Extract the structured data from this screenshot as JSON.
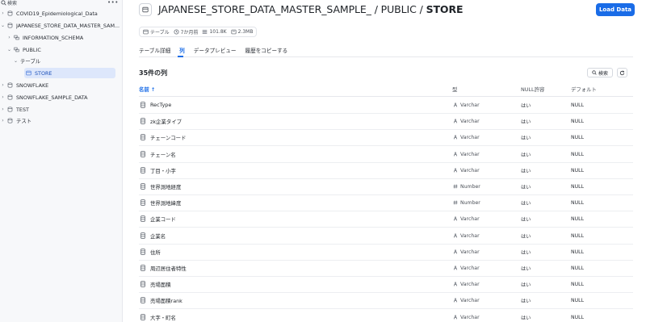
{
  "sidebar": {
    "search_placeholder": "検索",
    "more_label": "•••",
    "items": [
      {
        "label": "COVID19_Epidemiological_Data",
        "icon": "database-icon",
        "expand": "›"
      },
      {
        "label": "JAPANESE_STORE_DATA_MASTER_SAM...",
        "icon": "database-icon",
        "expand": "⌄"
      },
      {
        "label": "INFORMATION_SCHEMA",
        "icon": "schema-icon",
        "expand": "›"
      },
      {
        "label": "PUBLIC",
        "icon": "schema-icon",
        "expand": "⌄"
      },
      {
        "label": "テーブル",
        "icon": "",
        "expand": "⌄"
      },
      {
        "label": "STORE",
        "icon": "table-icon",
        "expand": ""
      },
      {
        "label": "SNOWFLAKE",
        "icon": "database-icon",
        "expand": "›"
      },
      {
        "label": "SNOWFLAKE_SAMPLE_DATA",
        "icon": "database-icon",
        "expand": "›"
      },
      {
        "label": "TEST",
        "icon": "database-icon",
        "expand": "›"
      },
      {
        "label": "テスト",
        "icon": "database-icon",
        "expand": "›"
      }
    ]
  },
  "header": {
    "title_path": "JAPANESE_STORE_DATA_MASTER_SAMPLE_ / PUBLIC / ",
    "title_current": "STORE",
    "load_button": "Load Data"
  },
  "meta": {
    "type": "テーブル",
    "age": "7か月前",
    "rows": "101.8K",
    "size": "2.3MB"
  },
  "tabs": [
    "テーブル詳細",
    "列",
    "データプレビュー",
    "履歴をコピーする"
  ],
  "columns_panel": {
    "count_label": "35件の列",
    "search_label": "検索",
    "headers": {
      "name": "名前",
      "sort_indicator": "↑",
      "type": "型",
      "nullable": "NULL許容",
      "default": "デフォルト"
    },
    "rows": [
      {
        "name": "RecType",
        "type": "Varchar",
        "nullable": "はい",
        "default": "NULL"
      },
      {
        "name": "zk企業タイプ",
        "type": "Varchar",
        "nullable": "はい",
        "default": "NULL"
      },
      {
        "name": "チェーンコード",
        "type": "Varchar",
        "nullable": "はい",
        "default": "NULL"
      },
      {
        "name": "チェーン名",
        "type": "Varchar",
        "nullable": "はい",
        "default": "NULL"
      },
      {
        "name": "丁目・小字",
        "type": "Varchar",
        "nullable": "はい",
        "default": "NULL"
      },
      {
        "name": "世界測地経度",
        "type": "Number",
        "nullable": "はい",
        "default": "NULL"
      },
      {
        "name": "世界測地緯度",
        "type": "Number",
        "nullable": "はい",
        "default": "NULL"
      },
      {
        "name": "企業コード",
        "type": "Varchar",
        "nullable": "はい",
        "default": "NULL"
      },
      {
        "name": "企業名",
        "type": "Varchar",
        "nullable": "はい",
        "default": "NULL"
      },
      {
        "name": "住所",
        "type": "Varchar",
        "nullable": "はい",
        "default": "NULL"
      },
      {
        "name": "周辺居住者特性",
        "type": "Varchar",
        "nullable": "はい",
        "default": "NULL"
      },
      {
        "name": "売場面積",
        "type": "Varchar",
        "nullable": "はい",
        "default": "NULL"
      },
      {
        "name": "売場面積rank",
        "type": "Varchar",
        "nullable": "はい",
        "default": "NULL"
      },
      {
        "name": "大字・町名",
        "type": "Varchar",
        "nullable": "はい",
        "default": "NULL"
      }
    ]
  },
  "colors": {
    "accent": "#1a6ce7",
    "selected_bg": "#dde7fb",
    "sidebar_bg": "#f7f8fa"
  }
}
